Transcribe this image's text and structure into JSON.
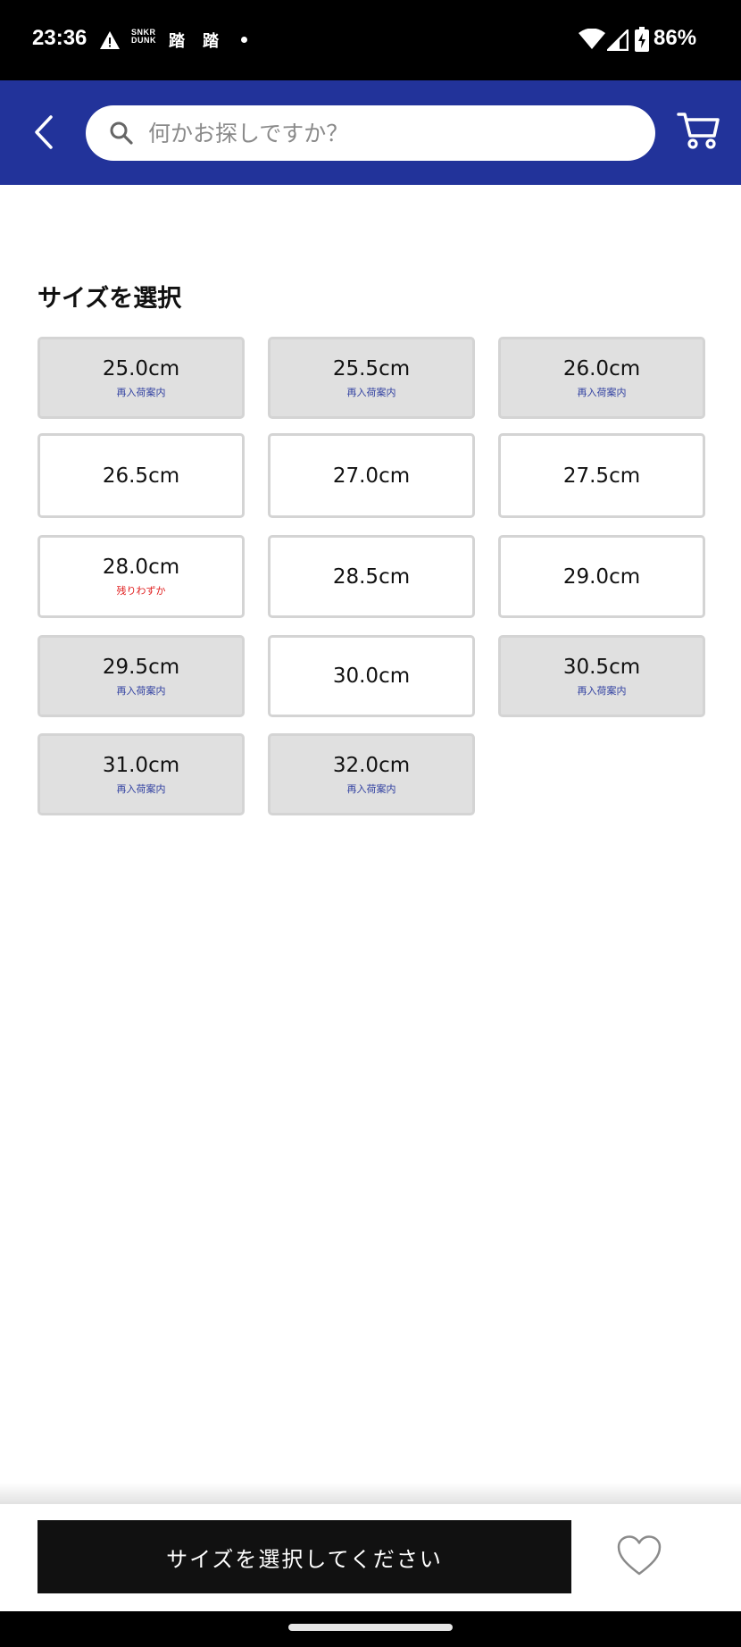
{
  "status_bar": {
    "time": "23:36",
    "notifications": {
      "warning": "warning-icon",
      "snkr_logo": [
        "SNKR",
        "DUNK"
      ],
      "app_glyph_1": "踏",
      "app_glyph_2": "踏",
      "more": "dot-icon"
    },
    "battery_percent": "86%",
    "icons": [
      "wifi-icon",
      "signal-icon",
      "battery-charging-icon"
    ]
  },
  "header": {
    "back_icon": "chevron-left-icon",
    "search_placeholder": "何かお探しですか？",
    "search_value": "",
    "cart_icon": "cart-icon",
    "bg_color": "#22339a"
  },
  "main": {
    "title": "サイズを選択",
    "sizes": [
      {
        "label": "25.0cm",
        "note": "再入荷案内",
        "state": "restock"
      },
      {
        "label": "25.5cm",
        "note": "再入荷案内",
        "state": "restock"
      },
      {
        "label": "26.0cm",
        "note": "再入荷案内",
        "state": "restock"
      },
      {
        "label": "26.5cm",
        "note": "",
        "state": "available"
      },
      {
        "label": "27.0cm",
        "note": "",
        "state": "available"
      },
      {
        "label": "27.5cm",
        "note": "",
        "state": "available"
      },
      {
        "label": "28.0cm",
        "note": "残りわずか",
        "state": "low"
      },
      {
        "label": "28.5cm",
        "note": "",
        "state": "available"
      },
      {
        "label": "29.0cm",
        "note": "",
        "state": "available"
      },
      {
        "label": "29.5cm",
        "note": "再入荷案内",
        "state": "restock"
      },
      {
        "label": "30.0cm",
        "note": "",
        "state": "available"
      },
      {
        "label": "30.5cm",
        "note": "再入荷案内",
        "state": "restock"
      },
      {
        "label": "31.0cm",
        "note": "再入荷案内",
        "state": "restock"
      },
      {
        "label": "32.0cm",
        "note": "再入荷案内",
        "state": "restock"
      }
    ],
    "colors": {
      "restock_note": "#2f3fa0",
      "low_note": "#e02020",
      "unavailable_bg": "#e0e0e0"
    }
  },
  "bottom_bar": {
    "select_button_label": "サイズを選択してください",
    "favorite_icon": "heart-outline-icon"
  }
}
